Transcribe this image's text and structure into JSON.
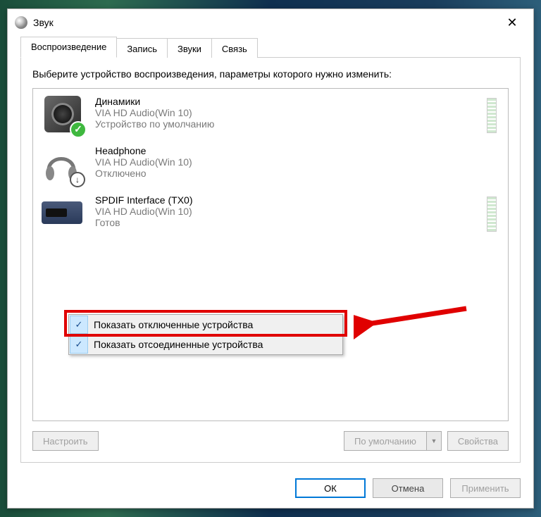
{
  "window": {
    "title": "Звук",
    "close": "✕"
  },
  "tabs": [
    "Воспроизведение",
    "Запись",
    "Звуки",
    "Связь"
  ],
  "instruction": "Выберите устройство воспроизведения, параметры которого нужно изменить:",
  "devices": [
    {
      "name": "Динамики",
      "driver": "VIA HD Audio(Win 10)",
      "status": "Устройство по умолчанию",
      "default": true,
      "meter": true
    },
    {
      "name": "Headphone",
      "driver": "VIA HD Audio(Win 10)",
      "status": "Отключено",
      "disabled": true
    },
    {
      "name": "SPDIF Interface (TX0)",
      "driver": "VIA HD Audio(Win 10)",
      "status": "Готов",
      "meter": true
    }
  ],
  "context_menu": [
    "Показать отключенные устройства",
    "Показать отсоединенные устройства"
  ],
  "panel_buttons": {
    "configure": "Настроить",
    "default": "По умолчанию",
    "properties": "Свойства"
  },
  "dialog_buttons": {
    "ok": "ОК",
    "cancel": "Отмена",
    "apply": "Применить"
  }
}
